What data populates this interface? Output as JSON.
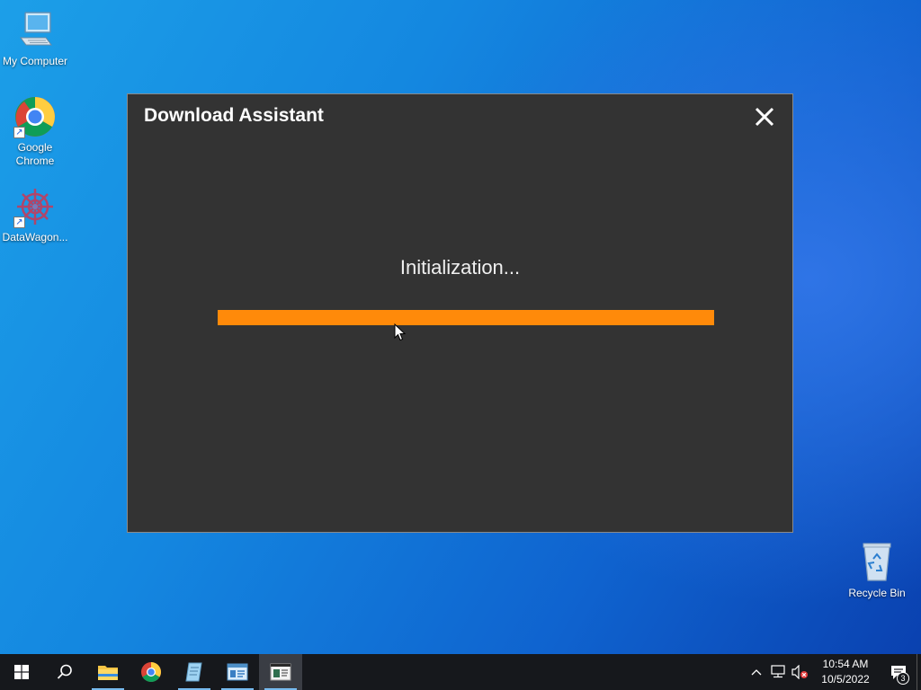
{
  "desktop": {
    "icons": [
      {
        "label": "My Computer",
        "icon": "computer-icon"
      },
      {
        "label": "Google Chrome",
        "icon": "chrome-icon"
      },
      {
        "label": "DataWagon...",
        "icon": "datawagon-icon"
      },
      {
        "label": "Recycle Bin",
        "icon": "recycle-bin-icon"
      }
    ]
  },
  "dialog": {
    "title": "Download Assistant",
    "status": "Initialization...",
    "progress_fraction": 1.0,
    "progress_color": "#ff8a0a",
    "close_icon": "close-icon"
  },
  "taskbar": {
    "pinned": [
      {
        "name": "start-button",
        "icon": "windows-logo-icon"
      },
      {
        "name": "search-button",
        "icon": "search-icon"
      },
      {
        "name": "file-explorer-button",
        "icon": "folder-icon"
      },
      {
        "name": "chrome-taskbar-button",
        "icon": "chrome-icon"
      },
      {
        "name": "notepad-taskbar-button",
        "icon": "notepad-icon"
      },
      {
        "name": "control-panel-taskbar-button",
        "icon": "control-panel-icon"
      },
      {
        "name": "download-assistant-taskbar-button",
        "icon": "app-window-icon"
      }
    ],
    "tray": {
      "time": "10:54 AM",
      "date": "10/5/2022",
      "notification_count": "3"
    }
  }
}
